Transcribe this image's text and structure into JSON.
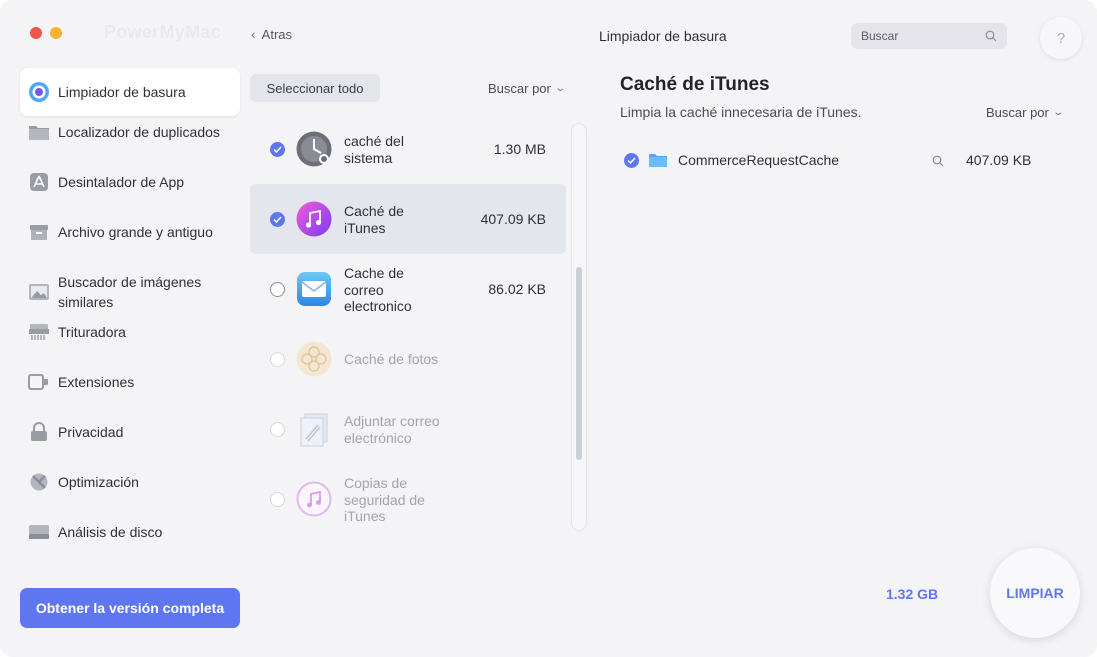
{
  "window": {
    "app_name": "PowerMyMac",
    "back_label": "Atras",
    "section_title": "Limpiador de basura",
    "search_placeholder": "Buscar",
    "help_label": "?"
  },
  "sidebar": {
    "items": [
      {
        "label": "Limpiador de basura",
        "icon": "junk-cleaner-icon",
        "active": true
      },
      {
        "label": "Localizador de duplicados",
        "icon": "folder-icon"
      },
      {
        "label": "Desintalador de App",
        "icon": "app-store-icon"
      },
      {
        "label": "Archivo grande y antiguo",
        "icon": "archive-box-icon"
      },
      {
        "label_line1": "Buscador de imágenes",
        "label_line2": "similares",
        "icon": "image-icon"
      },
      {
        "label": "Trituradora",
        "icon": "shredder-icon"
      },
      {
        "label": "Extensiones",
        "icon": "extension-icon"
      },
      {
        "label": "Privacidad",
        "icon": "lock-icon"
      },
      {
        "label": "Optimización",
        "icon": "optimization-icon"
      },
      {
        "label": "Análisis de disco",
        "icon": "disk-icon"
      }
    ],
    "upgrade_label": "Obtener la versión completa"
  },
  "list": {
    "select_all_label": "Seleccionar todo",
    "sort_label": "Buscar por",
    "items": [
      {
        "label_lines": [
          "caché del",
          "sistema"
        ],
        "size": "1.30 MB",
        "checked": true,
        "icon": "system-cache-icon"
      },
      {
        "label_lines": [
          "Caché de",
          "iTunes"
        ],
        "size": "407.09 KB",
        "checked": true,
        "selected": true,
        "icon": "itunes-icon"
      },
      {
        "label_lines": [
          "Cache de",
          "correo",
          "electronico"
        ],
        "size": "86.02 KB",
        "checked": false,
        "icon": "mail-icon"
      },
      {
        "label_lines": [
          "Caché de fotos"
        ],
        "size": "",
        "checked": false,
        "disabled": true,
        "icon": "photos-icon"
      },
      {
        "label_lines": [
          "Adjuntar correo",
          "electrónico"
        ],
        "size": "",
        "checked": false,
        "disabled": true,
        "icon": "mail-attachment-icon"
      },
      {
        "label_lines": [
          "Copias de",
          "seguridad de",
          "iTunes"
        ],
        "size": "",
        "checked": false,
        "disabled": true,
        "icon": "itunes-backup-icon"
      }
    ]
  },
  "detail": {
    "title": "Caché de iTunes",
    "description": "Limpia la caché innecesaria de iTunes.",
    "sort_label": "Buscar por",
    "files": [
      {
        "name": "CommerceRequestCache",
        "size": "407.09 KB",
        "checked": true
      }
    ]
  },
  "footer": {
    "total": "1.32 GB",
    "clean_label": "LIMPIAR"
  },
  "colors": {
    "accent": "#5e76f0",
    "background": "#f4f4f7"
  }
}
